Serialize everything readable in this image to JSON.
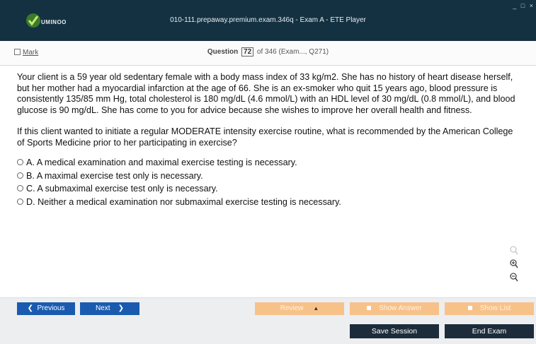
{
  "app": {
    "logo_text": "UMINOO",
    "window_title": "010-111.prepaway.premium.exam.346q - Exam A - ETE Player",
    "window_controls": "_ □ ×"
  },
  "subbar": {
    "mark_label": "Mark",
    "question_word": "Question",
    "question_number": "72",
    "question_total_text": "of 346 (Exam..., Q271)"
  },
  "question": {
    "paragraph1": "Your client is a 59 year old sedentary female with a body mass index of 33 kg/m2. She has no history of heart disease herself, but her mother had a myocardial infarction at the age of 66. She is an ex-smoker who quit 15 years ago, blood pressure is consistently 135/85 mm Hg, total cholesterol is 180 mg/dL (4.6 mmol/L) with an HDL level of 30 mg/dL (0.8 mmol/L), and blood glucose is 90 mg/dL. She has come to you for advice because she wishes to improve her overall health and fitness.",
    "paragraph2": "If this client wanted to initiate a regular MODERATE intensity exercise routine, what is recommended by the American College of Sports Medicine prior to her participating in exercise?",
    "answers": [
      "A. A medical examination and maximal exercise testing is necessary.",
      "B. A maximal exercise test only is necessary.",
      "C. A submaximal exercise test only is necessary.",
      "D. Neither a medical examination nor submaximal exercise testing is necessary."
    ]
  },
  "side_icons": [
    "search-icon",
    "zoom-in-icon",
    "zoom-out-icon"
  ],
  "nav": {
    "previous": "Previous",
    "next": "Next",
    "review": "Review",
    "show_answer": "Show Answer",
    "show_list": "Show List",
    "save_session": "Save Session",
    "end_exam": "End Exam"
  },
  "colors": {
    "titlebar": "#143142",
    "nav_blue": "#1a5bb0",
    "nav_orange": "#f7c28a",
    "dark_button": "#1c2c3a"
  }
}
